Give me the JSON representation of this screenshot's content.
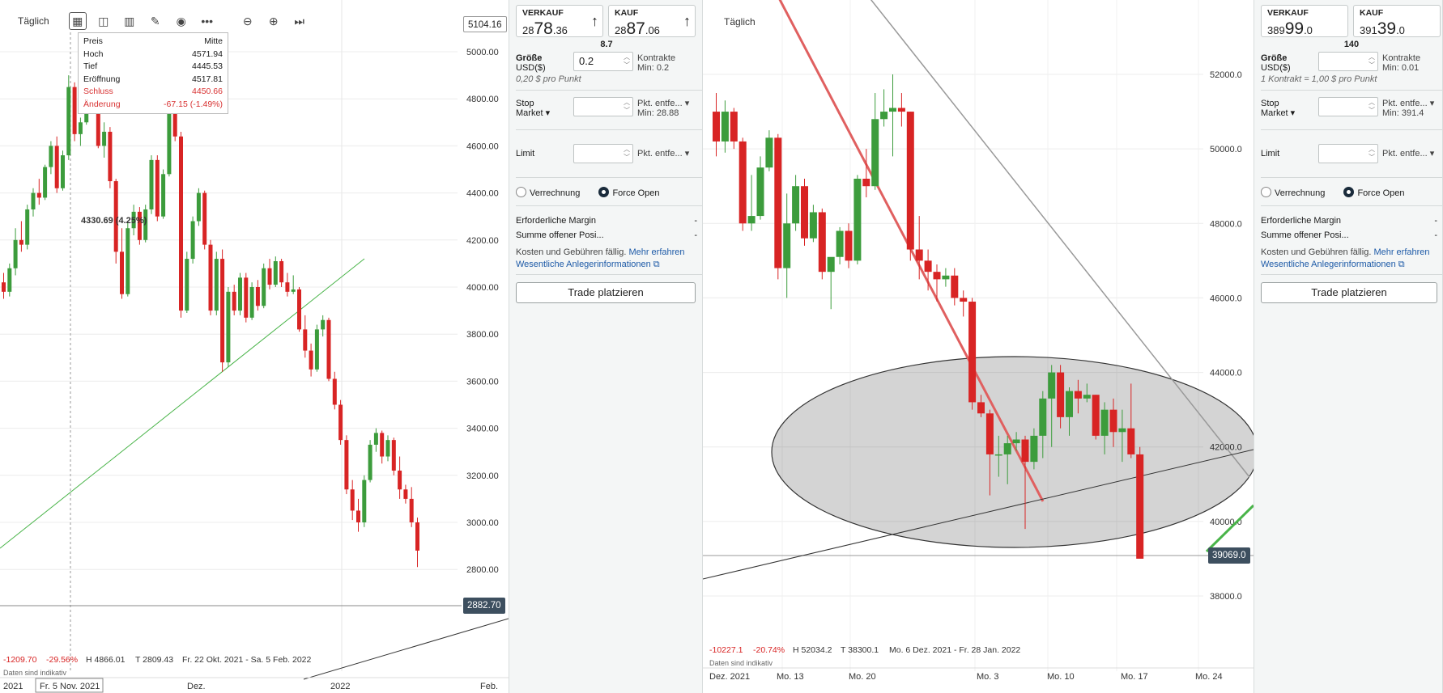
{
  "left_chart": {
    "timeframe": "Täglich",
    "tooltip": {
      "header": [
        "Preis",
        "Mitte"
      ],
      "rows": [
        {
          "label": "Hoch",
          "value": "4571.94"
        },
        {
          "label": "Tief",
          "value": "4445.53"
        },
        {
          "label": "Eröffnung",
          "value": "4517.81"
        },
        {
          "label": "Schluss",
          "value": "4450.66"
        },
        {
          "label": "Änderung",
          "value": "-67.15 (-1.49%)"
        }
      ]
    },
    "crosshair_label": "4330.69 (4.25%)",
    "price_top_label": "5104.16",
    "last_price": "2882.70",
    "y_ticks": [
      "5000.00",
      "4800.00",
      "4600.00",
      "4400.00",
      "4200.00",
      "4000.00",
      "3800.00",
      "3600.00",
      "3400.00",
      "3200.00",
      "3000.00",
      "2800.00"
    ],
    "stats": {
      "change": "-1209.70",
      "pct": "-29.56%",
      "high": "H 4866.01",
      "low": "T 2809.43",
      "range": "Fr. 22 Okt. 2021 - Sa. 5 Feb. 2022"
    },
    "indicative": "Daten sind indikativ",
    "x_labels": {
      "a": "2021",
      "cursor": "Fr. 5 Nov. 2021",
      "b": "Dez.",
      "c": "2022",
      "d": "Feb."
    }
  },
  "left_ticket": {
    "sell_label": "VERKAUF",
    "sell_small": "28",
    "sell_big": "78",
    "sell_dec": ".36",
    "buy_label": "KAUF",
    "buy_small": "28",
    "buy_big": "87",
    "buy_dec": ".06",
    "spread": "8.7",
    "size_label": "Größe",
    "size_unit": "USD($)",
    "size_value": "0.2",
    "size_side1": "Kontrakte",
    "size_side2": "Min: 0.2",
    "size_note": "0,20 $ pro Punkt",
    "stop_label": "Stop",
    "stop_type": "Market",
    "stop_side1": "Pkt. entfe...",
    "stop_side2": "Min: 28.88",
    "limit_label": "Limit",
    "limit_side": "Pkt. entfe...",
    "opt1": "Verrechnung",
    "opt2": "Force Open",
    "margin_label": "Erforderliche Margin",
    "margin_value": "-",
    "open_label": "Summe offener Posi...",
    "open_value": "-",
    "costs_text": "Kosten und Gebühren fällig.",
    "costs_link": "Mehr erfahren",
    "info_link": "Wesentliche Anlegerinformationen",
    "trade_button": "Trade platzieren"
  },
  "right_chart": {
    "timeframe": "Täglich",
    "y_ticks": [
      "52000.0",
      "50000.0",
      "48000.0",
      "46000.0",
      "44000.0",
      "42000.0",
      "40000.0",
      "38000.0"
    ],
    "last_price": "39069.0",
    "stats": {
      "change": "-10227.1",
      "pct": "-20.74%",
      "high": "H 52034.2",
      "low": "T 38300.1",
      "range": "Mo. 6 Dez. 2021 - Fr. 28 Jan. 2022"
    },
    "indicative": "Daten sind indikativ",
    "x_labels": [
      "Dez. 2021",
      "Mo. 13",
      "Mo. 20",
      "Mo. 3",
      "Mo. 10",
      "Mo. 17",
      "Mo. 24"
    ]
  },
  "right_ticket": {
    "sell_label": "VERKAUF",
    "sell_small": "389",
    "sell_big": "99",
    "sell_dec": ".0",
    "buy_label": "KAUF",
    "buy_small": "391",
    "buy_big": "39",
    "buy_dec": ".0",
    "spread": "140",
    "size_label": "Größe",
    "size_unit": "USD($)",
    "size_value": "",
    "size_side1": "Kontrakte",
    "size_side2": "Min: 0.01",
    "size_note": "1 Kontrakt = 1,00 $ pro Punkt",
    "stop_label": "Stop",
    "stop_type": "Market",
    "stop_side1": "Pkt. entfe...",
    "stop_side2": "Min: 391.4",
    "limit_label": "Limit",
    "limit_side": "Pkt. entfe...",
    "opt1": "Verrechnung",
    "opt2": "Force Open",
    "margin_label": "Erforderliche Margin",
    "margin_value": "-",
    "open_label": "Summe offener Posi...",
    "open_value": "-",
    "costs_text": "Kosten und Gebühren fällig.",
    "costs_link": "Mehr erfahren",
    "info_link": "Wesentliche Anlegerinformationen",
    "trade_button": "Trade platzieren"
  },
  "colors": {
    "up": "#3c9c3c",
    "down": "#d82424",
    "accent": "#1d5aa7",
    "tag": "#3d4f5f"
  },
  "chart_data": [
    {
      "type": "candlestick",
      "series_note": "Daily candles, left pane",
      "ylim": [
        2700,
        5104.16
      ],
      "candles": [
        [
          4020,
          4060,
          3950,
          3980
        ],
        [
          3980,
          4100,
          3960,
          4080
        ],
        [
          4080,
          4250,
          4050,
          4200
        ],
        [
          4200,
          4280,
          4150,
          4180
        ],
        [
          4180,
          4350,
          4160,
          4330
        ],
        [
          4330,
          4420,
          4300,
          4400
        ],
        [
          4400,
          4460,
          4350,
          4380
        ],
        [
          4380,
          4520,
          4370,
          4510
        ],
        [
          4510,
          4620,
          4480,
          4600
        ],
        [
          4600,
          4640,
          4400,
          4420
        ],
        [
          4420,
          4580,
          4410,
          4560
        ],
        [
          4560,
          4900,
          4540,
          4850
        ],
        [
          4850,
          4870,
          4620,
          4650
        ],
        [
          4650,
          4720,
          4600,
          4700
        ],
        [
          4700,
          4780,
          4690,
          4760
        ],
        [
          4760,
          4850,
          4740,
          4820
        ],
        [
          4820,
          4840,
          4590,
          4600
        ],
        [
          4600,
          4700,
          4550,
          4660
        ],
        [
          4660,
          4680,
          4420,
          4450
        ],
        [
          4450,
          4460,
          4100,
          4150
        ],
        [
          4150,
          4250,
          3950,
          3970
        ],
        [
          3970,
          4280,
          3960,
          4250
        ],
        [
          4250,
          4350,
          4220,
          4320
        ],
        [
          4320,
          4340,
          4180,
          4200
        ],
        [
          4200,
          4350,
          4190,
          4330
        ],
        [
          4330,
          4560,
          4310,
          4540
        ],
        [
          4540,
          4560,
          4280,
          4300
        ],
        [
          4300,
          4500,
          4290,
          4480
        ],
        [
          4480,
          4820,
          4470,
          4800
        ],
        [
          4800,
          4810,
          4620,
          4640
        ],
        [
          4640,
          4660,
          3870,
          3900
        ],
        [
          3900,
          4150,
          3890,
          4120
        ],
        [
          4120,
          4300,
          4100,
          4280
        ],
        [
          4280,
          4420,
          4260,
          4400
        ],
        [
          4400,
          4410,
          4160,
          4180
        ],
        [
          4180,
          4200,
          3880,
          3900
        ],
        [
          3900,
          4150,
          3880,
          4120
        ],
        [
          4120,
          4160,
          3640,
          3680
        ],
        [
          3680,
          4000,
          3660,
          3980
        ],
        [
          3980,
          4010,
          3880,
          3900
        ],
        [
          3900,
          4060,
          3880,
          4040
        ],
        [
          4040,
          4060,
          3850,
          3870
        ],
        [
          3870,
          4020,
          3860,
          4000
        ],
        [
          4000,
          4030,
          3900,
          3920
        ],
        [
          3920,
          4100,
          3910,
          4080
        ],
        [
          4080,
          4120,
          3990,
          4010
        ],
        [
          4010,
          4130,
          4000,
          4110
        ],
        [
          4110,
          4120,
          4000,
          4020
        ],
        [
          4020,
          4060,
          3960,
          3980
        ],
        [
          3980,
          4050,
          3970,
          3990
        ],
        [
          3990,
          4000,
          3810,
          3820
        ],
        [
          3820,
          3880,
          3700,
          3730
        ],
        [
          3730,
          3760,
          3620,
          3650
        ],
        [
          3650,
          3840,
          3640,
          3820
        ],
        [
          3820,
          3880,
          3790,
          3860
        ],
        [
          3860,
          3870,
          3600,
          3610
        ],
        [
          3610,
          3640,
          3480,
          3500
        ],
        [
          3500,
          3520,
          3330,
          3350
        ],
        [
          3350,
          3370,
          3120,
          3140
        ],
        [
          3140,
          3180,
          3010,
          3050
        ],
        [
          3050,
          3100,
          2960,
          3000
        ],
        [
          3000,
          3200,
          2980,
          3180
        ],
        [
          3180,
          3350,
          3170,
          3330
        ],
        [
          3330,
          3400,
          3300,
          3380
        ],
        [
          3380,
          3390,
          3250,
          3280
        ],
        [
          3280,
          3370,
          3260,
          3350
        ],
        [
          3350,
          3360,
          3200,
          3220
        ],
        [
          3220,
          3280,
          3100,
          3140
        ],
        [
          3140,
          3160,
          3080,
          3100
        ],
        [
          3100,
          3150,
          2980,
          3000
        ],
        [
          3000,
          3020,
          2810,
          2880
        ]
      ]
    },
    {
      "type": "candlestick",
      "series_note": "Daily candles, right pane",
      "ylim": [
        37400,
        53600
      ],
      "candles": [
        [
          51000,
          51500,
          49800,
          50200
        ],
        [
          50200,
          51300,
          49900,
          51000
        ],
        [
          51000,
          51100,
          50000,
          50200
        ],
        [
          50200,
          50300,
          47800,
          48000
        ],
        [
          48000,
          49300,
          47800,
          48200
        ],
        [
          48200,
          49800,
          48100,
          49500
        ],
        [
          49500,
          50500,
          49400,
          50300
        ],
        [
          50300,
          50400,
          46500,
          46800
        ],
        [
          46800,
          48800,
          46000,
          48000
        ],
        [
          48000,
          49300,
          47800,
          49000
        ],
        [
          49000,
          49200,
          47400,
          47600
        ],
        [
          47600,
          48500,
          47500,
          48300
        ],
        [
          48300,
          48400,
          46500,
          46700
        ],
        [
          46700,
          47000,
          45700,
          47100
        ],
        [
          47100,
          47900,
          46900,
          47800
        ],
        [
          47800,
          48000,
          46800,
          47000
        ],
        [
          47000,
          49300,
          46900,
          49200
        ],
        [
          49200,
          50000,
          48700,
          49000
        ],
        [
          49000,
          51500,
          48900,
          50800
        ],
        [
          50800,
          51600,
          50600,
          51000
        ],
        [
          51000,
          52000,
          49800,
          51100
        ],
        [
          51100,
          51500,
          50600,
          51000
        ],
        [
          51000,
          51000,
          47000,
          47300
        ],
        [
          47300,
          48200,
          46500,
          47000
        ],
        [
          47000,
          47300,
          46200,
          46700
        ],
        [
          46700,
          46900,
          45900,
          46500
        ],
        [
          46500,
          46800,
          46300,
          46600
        ],
        [
          46600,
          46800,
          45800,
          46000
        ],
        [
          46000,
          46200,
          45500,
          45900
        ],
        [
          45900,
          46000,
          43000,
          43200
        ],
        [
          43200,
          43400,
          42800,
          42900
        ],
        [
          42900,
          43000,
          40700,
          41800
        ],
        [
          41800,
          42300,
          41200,
          41800
        ],
        [
          41800,
          42300,
          41000,
          42100
        ],
        [
          42100,
          42400,
          41900,
          42200
        ],
        [
          42200,
          42300,
          39800,
          41600
        ],
        [
          41600,
          42500,
          41400,
          42300
        ],
        [
          42300,
          43500,
          41700,
          43300
        ],
        [
          43300,
          44200,
          42000,
          44000
        ],
        [
          44000,
          44200,
          42500,
          42800
        ],
        [
          42800,
          43600,
          42300,
          43500
        ],
        [
          43500,
          43800,
          42900,
          43300
        ],
        [
          43300,
          43700,
          43200,
          43400
        ],
        [
          43400,
          43400,
          42200,
          42300
        ],
        [
          42300,
          43200,
          41800,
          43000
        ],
        [
          43000,
          43300,
          42000,
          42400
        ],
        [
          42400,
          43000,
          41600,
          42500
        ],
        [
          42500,
          43700,
          41700,
          41800
        ],
        [
          41800,
          42000,
          39100,
          39000
        ]
      ]
    }
  ]
}
